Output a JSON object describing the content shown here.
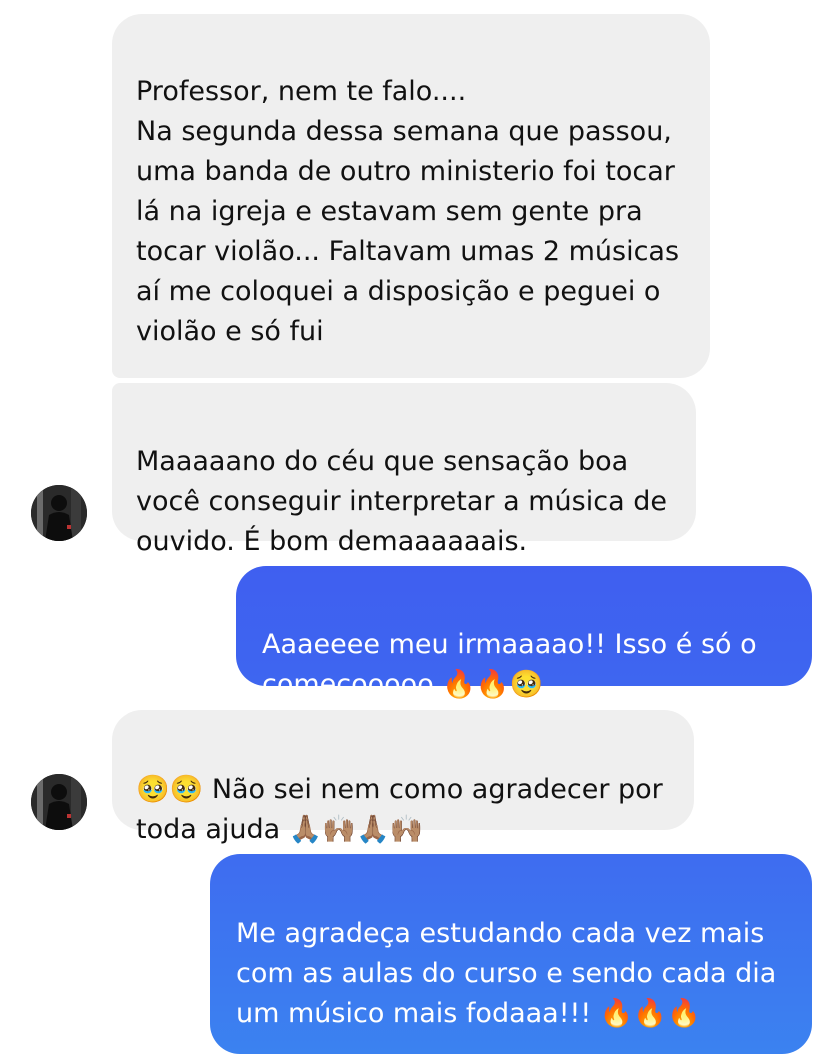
{
  "chat": {
    "messages": [
      {
        "direction": "incoming",
        "text": "Professor, nem te falo....\nNa segunda dessa semana que passou, uma banda de outro ministerio foi tocar lá na igreja e estavam sem gente pra tocar violão... Faltavam umas 2 músicas aí me coloquei a disposição e peguei o violão e só fui"
      },
      {
        "direction": "incoming",
        "text": "Maaaaano do céu que sensação boa você conseguir interpretar a música de ouvido. É bom demaaaaaais.",
        "avatar_icon": "user-avatar"
      },
      {
        "direction": "outgoing",
        "text": "Aaaeeee meu irmaaaao!! Isso é só o começooooo 🔥🔥🥹"
      },
      {
        "direction": "incoming",
        "text": "🥹🥹 Não sei nem como agradecer por toda ajuda 🙏🏽🙌🏽🙏🏽🙌🏽",
        "avatar_icon": "user-avatar"
      },
      {
        "direction": "outgoing",
        "text": "Me agradeça estudando cada vez mais com as aulas do curso e sendo cada dia um músico mais fodaaa!!! 🔥🔥🔥"
      }
    ]
  },
  "colors": {
    "incoming_bubble": "#efefef",
    "outgoing_gradient_top": "#3f5ff0",
    "outgoing_gradient_bottom": "#3b82f0",
    "text_dark": "#111111",
    "text_light": "#ffffff"
  }
}
